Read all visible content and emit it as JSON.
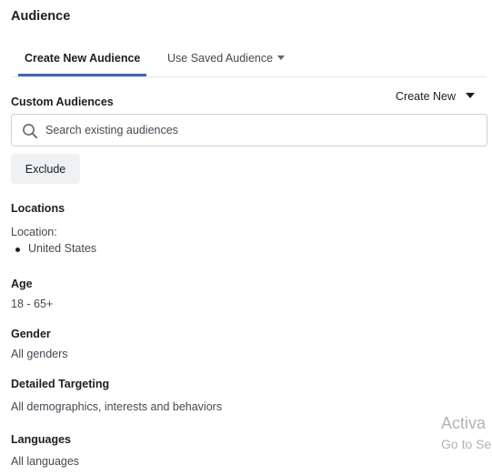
{
  "audience": {
    "title": "Audience",
    "tabs": [
      {
        "label": "Create New Audience",
        "active": true
      },
      {
        "label": "Use Saved Audience",
        "active": false
      }
    ],
    "custom_audiences": {
      "label": "Custom Audiences",
      "create_new_label": "Create New",
      "search_placeholder": "Search existing audiences",
      "search_value": "",
      "exclude_label": "Exclude"
    },
    "locations": {
      "label": "Locations",
      "sub_label": "Location:",
      "items": [
        "United States"
      ]
    },
    "age": {
      "label": "Age",
      "value": "18 - 65+"
    },
    "gender": {
      "label": "Gender",
      "value": "All genders"
    },
    "detailed_targeting": {
      "label": "Detailed Targeting",
      "value": "All demographics, interests and behaviors"
    },
    "languages": {
      "label": "Languages",
      "value": "All languages"
    }
  },
  "watermark": {
    "line1": "Activa",
    "line2": "Go to Se"
  },
  "colors": {
    "accent": "#4267b2",
    "text_primary": "#1c1e21",
    "text_secondary": "#444950",
    "border": "#ccd0d5",
    "button_bg": "#f0f1f3"
  },
  "icons": {
    "search": "search-icon",
    "tab_dropdown": "caret-down-icon",
    "create_new_dropdown": "caret-down-icon"
  }
}
